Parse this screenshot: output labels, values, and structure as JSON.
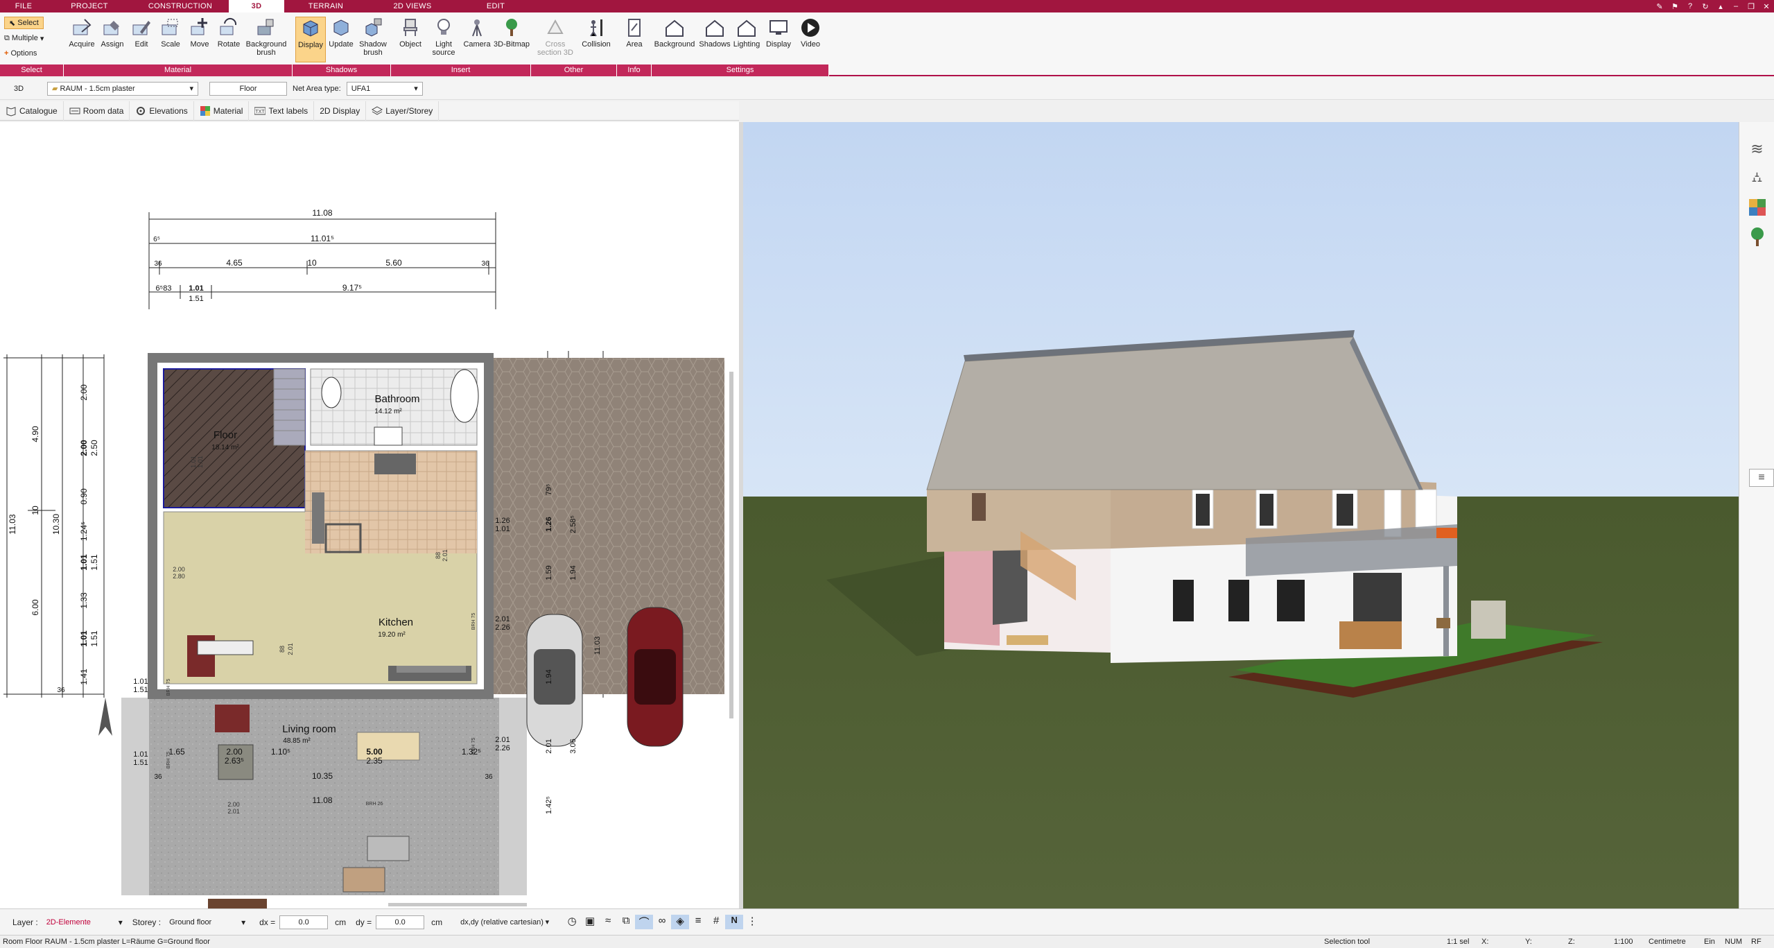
{
  "menu": {
    "tabs": [
      "FILE",
      "PROJECT",
      "CONSTRUCTION",
      "3D",
      "TERRAIN",
      "2D VIEWS",
      "EDIT"
    ],
    "active": "3D"
  },
  "ribbon": {
    "select": {
      "select_label": "Select",
      "multiple_label": "Multiple",
      "options_label": "Options",
      "group": "Select"
    },
    "material": {
      "group": "Material",
      "buttons": [
        "Acquire",
        "Assign",
        "Edit",
        "Scale",
        "Move",
        "Rotate",
        "Background brush"
      ]
    },
    "shadows": {
      "group": "Shadows",
      "buttons": [
        "Display",
        "Update",
        "Shadow brush"
      ]
    },
    "insert": {
      "group": "Insert",
      "buttons": [
        "Object",
        "Light source",
        "Camera",
        "3D-Bitmap"
      ]
    },
    "other": {
      "group": "Other",
      "buttons": [
        "Cross section 3D",
        "Collision"
      ]
    },
    "info": {
      "group": "Info",
      "buttons": [
        "Area"
      ]
    },
    "settings": {
      "group": "Settings",
      "buttons": [
        "Background",
        "Shadows",
        "Lighting",
        "Display",
        "Video"
      ]
    }
  },
  "propbar": {
    "mode": "3D",
    "material": "RAUM - 1.5cm plaster",
    "floor_value": "Floor",
    "net_area_label": "Net Area type:",
    "net_area_value": "UFA1"
  },
  "tooltabs": [
    "Catalogue",
    "Room data",
    "Elevations",
    "Material",
    "Text labels",
    "2D Display",
    "Layer/Storey"
  ],
  "plan": {
    "dims_top": {
      "total1": "11.08",
      "total2": "11.01⁵",
      "seg1": "4.65",
      "seg2": "10",
      "seg3": "5.60",
      "seg4": "36",
      "seg0": "36",
      "r3a": "6⁵83",
      "r3b": "1.01",
      "r3c": "1.51",
      "r3d": "9.17⁵",
      "r2small": "6⁵"
    },
    "dims_left": {
      "a": "4.90",
      "b": "10",
      "c": "10.30",
      "d": "11.03",
      "e": "6.00",
      "f": "2.00",
      "g": "2.00",
      "h": "2.50",
      "i": "0.90",
      "j": "1.24⁵",
      "k": "1.01",
      "l": "1.51",
      "m": "1.33",
      "n": "1.01",
      "o": "1.51",
      "p": "1.41",
      "q": "36",
      "r": "1.01",
      "s": "1.51",
      "t": "1.01",
      "u": "1.51"
    },
    "rooms": [
      {
        "name": "Floor",
        "area": "18.14 m²"
      },
      {
        "name": "Bathroom",
        "area": "14.12 m²"
      },
      {
        "name": "Kitchen",
        "area": "19.20 m²"
      },
      {
        "name": "Living room",
        "area": "48.85 m²"
      }
    ],
    "dims_right": {
      "a": "1.26",
      "b": "1.01",
      "c": "2.01",
      "d": "2.26",
      "e": "2.01",
      "f": "2.26",
      "g": "1.26",
      "h": "2.58⁵",
      "i": "1.59",
      "j": "1.94",
      "k": "1.94",
      "l": "2.01",
      "m": "3.06",
      "n": "11.03",
      "o": "1.42⁵",
      "p": "79⁵"
    },
    "dims_terrace": {
      "a": "1.65",
      "b": "2.00",
      "c": "2.63⁵",
      "d": "1.10⁵",
      "e": "5.00",
      "f": "2.35",
      "g": "1.32⁵",
      "h": "10.35",
      "i": "11.08",
      "j": "36",
      "k": "36"
    },
    "small_labels": {
      "brh1": "BRH 75",
      "brh2": "BRH 75",
      "brh3": "BRH 26",
      "brh4": "BRH 75",
      "brh5": "BRH 75",
      "stair1": "2.00",
      "stair2": "2.80",
      "door1": "2.01",
      "door2": "88",
      "k1": "88",
      "k2": "2.01",
      "l1": "2.00",
      "l2": "2.01",
      "f1": "1.01",
      "f2": "1.01"
    }
  },
  "status": {
    "layer_label": "Layer :",
    "layer_value": "2D-Elemente",
    "storey_label": "Storey :",
    "storey_value": "Ground floor",
    "dx_label": "dx =",
    "dx_value": "0.0",
    "dx_unit": "cm",
    "dy_label": "dy =",
    "dy_value": "0.0",
    "dy_unit": "cm",
    "coord_mode": "dx,dy (relative cartesian)"
  },
  "bottom": {
    "info": "Room Floor RAUM - 1.5cm plaster L=Räume G=Ground floor",
    "tool": "Selection tool",
    "sel": "1:1 sel",
    "x": "X:",
    "y": "Y:",
    "z": "Z:",
    "scale": "1:100",
    "unit": "Centimetre",
    "ein": "Ein",
    "num": "NUM",
    "rf": "RF"
  },
  "colors": {
    "brand": "#a1163f",
    "accent_group": "#c2285a",
    "selected": "#fbd48a"
  }
}
